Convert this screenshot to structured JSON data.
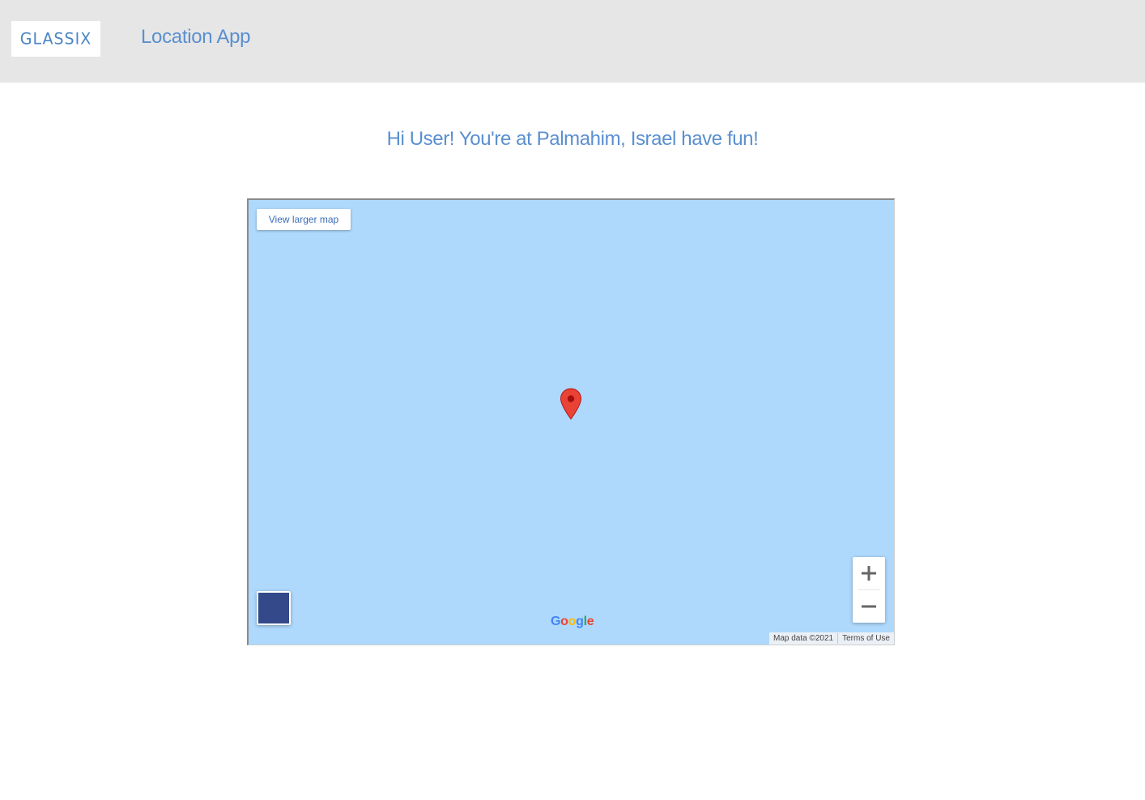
{
  "header": {
    "logo_text": "GLASSIX",
    "app_title": "Location App",
    "background": "#e6e6e6"
  },
  "main": {
    "greeting": "Hi User! You're at Palmahim, Israel have fun!"
  },
  "map": {
    "view_larger_label": "View larger map",
    "zoom_in_icon": "plus-icon",
    "zoom_out_icon": "minus-icon",
    "marker_icon": "map-pin-icon",
    "map_data_label": "Map data ©2021",
    "terms_label": "Terms of Use",
    "water_color": "#aed8fc",
    "marker_color": "#ea4335",
    "accent_color": "#5a8fd0"
  }
}
